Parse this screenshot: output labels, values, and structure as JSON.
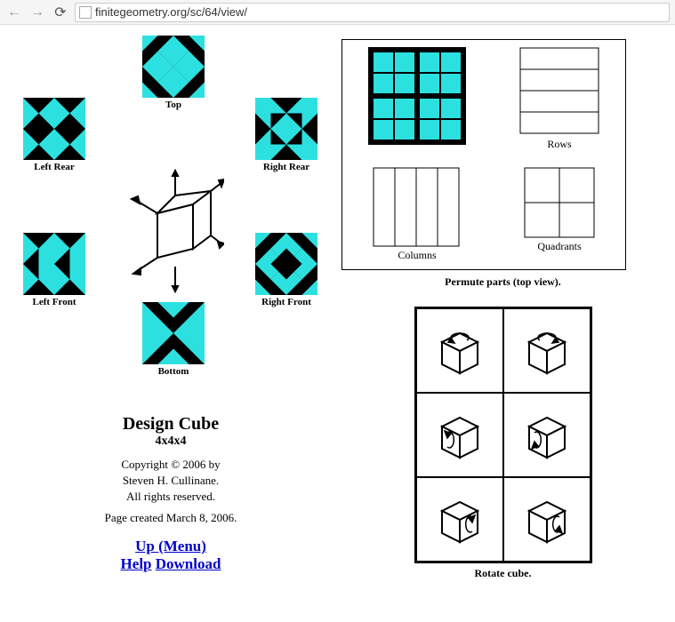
{
  "browser": {
    "url": "finitegeometry.org/sc/64/view/"
  },
  "faces": {
    "top": "Top",
    "leftRear": "Left Rear",
    "rightRear": "Right Rear",
    "leftFront": "Left Front",
    "rightFront": "Right Front",
    "bottom": "Bottom"
  },
  "title": {
    "main": "Design Cube",
    "sub": "4x4x4"
  },
  "copyright": {
    "line1": "Copyright © 2006 by",
    "line2": "Steven H. Cullinane.",
    "line3": "All rights reserved.",
    "created": "Page created March 8, 2006."
  },
  "links": {
    "up": "Up (Menu)",
    "help": "Help",
    "download": "Download"
  },
  "permute": {
    "rows": "Rows",
    "columns": "Columns",
    "quadrants": "Quadrants",
    "caption": "Permute parts (top view)."
  },
  "rotate": {
    "caption": "Rotate cube."
  }
}
